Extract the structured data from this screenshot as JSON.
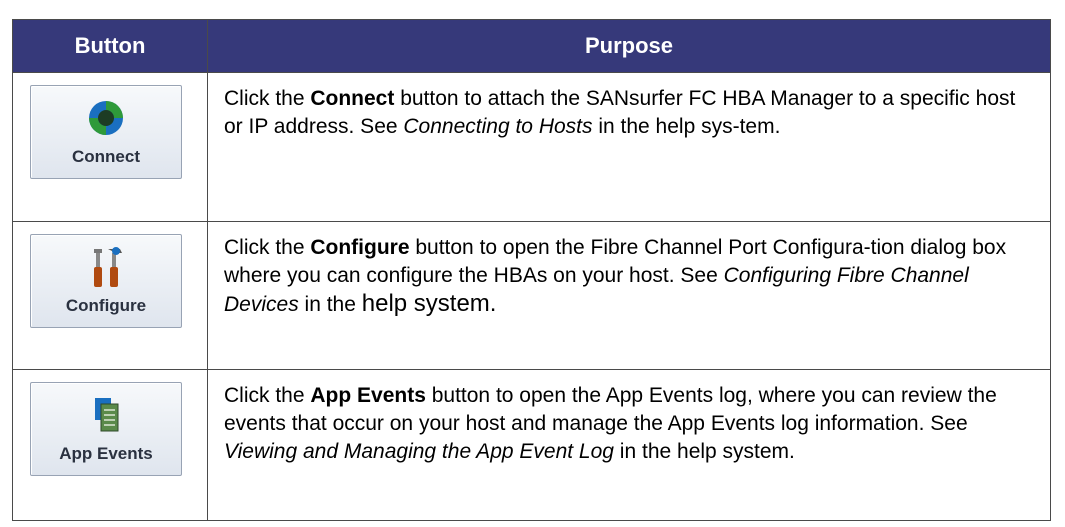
{
  "header": {
    "col_button": "Button",
    "col_purpose": "Purpose"
  },
  "rows": [
    {
      "button_label": "Connect",
      "icon": "connect-icon",
      "t1": "Click the ",
      "bold": "Connect",
      "t2": " button to attach the SANsurfer FC HBA Manager to a specific host or IP address. See ",
      "ital": "Connecting to Hosts",
      "t3": " in the help sys-tem."
    },
    {
      "button_label": "Configure",
      "icon": "configure-tools-icon",
      "t1": "Click the ",
      "bold": "Configure",
      "t2": " button to open the Fibre Channel Port Configura-tion dialog box where you can configure the HBAs on your host. See ",
      "ital": "Configuring Fibre Channel Devices",
      "t3": " in the ",
      "t4": "help system."
    },
    {
      "button_label": "App Events",
      "icon": "app-events-icon",
      "t1": "Click the ",
      "bold": "App Events",
      "t2": " button to open the App Events log, where you can review the events that occur on your host and manage the App Events log information. See ",
      "ital": "Viewing and Managing the App Event Log",
      "t3": " in the help system."
    }
  ]
}
